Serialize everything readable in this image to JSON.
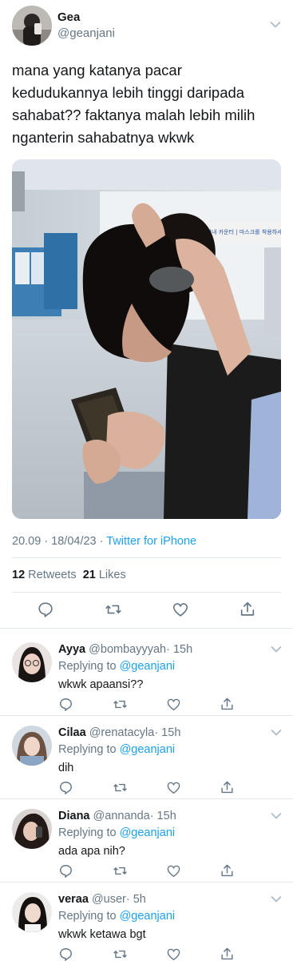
{
  "tweet": {
    "name": "Gea",
    "handle": "@geanjani",
    "text": "mana yang katanya pacar\nkedudukannya lebih tinggi daripada\nsahabat?? faktanya malah lebih milih\nnganterin sahabatnya wkwk",
    "photo_sign": "창원 터미널 안내 카운터 | 마스크를 착용하세요",
    "time_date": "20.09 · 18/04/23 · ",
    "source": "Twitter for iPhone",
    "retweets_count": "12",
    "retweets_label": "Retweets",
    "likes_count": "21",
    "likes_label": "Likes"
  },
  "icons": {
    "reply": "reply-icon",
    "retweet": "retweet-icon",
    "like": "heart-icon",
    "share": "share-icon",
    "more": "chevron-down-icon"
  },
  "colors": {
    "text": "#14171a",
    "muted": "#657786",
    "link": "#1da1f2",
    "divider": "#e1e8ed"
  },
  "replies": [
    {
      "name": "Ayya",
      "handle": "@bombayyyah",
      "time": "· 15h",
      "replying_to_prefix": "Replying to ",
      "replying_to": "@geanjani",
      "text": "wkwk apaansi??"
    },
    {
      "name": "Cilaa",
      "handle": "@renatacyla",
      "time": "· 15h",
      "replying_to_prefix": "Replying to ",
      "replying_to": "@geanjani",
      "text": "dih"
    },
    {
      "name": "Diana",
      "handle": "@annanda",
      "time": "· 15h",
      "replying_to_prefix": "Replying to ",
      "replying_to": "@geanjani",
      "text": "ada apa nih?"
    },
    {
      "name": "veraa",
      "handle": "@user",
      "time": "· 5h",
      "replying_to_prefix": "Replying to ",
      "replying_to": "@geanjani",
      "text": "wkwk ketawa bgt"
    }
  ]
}
